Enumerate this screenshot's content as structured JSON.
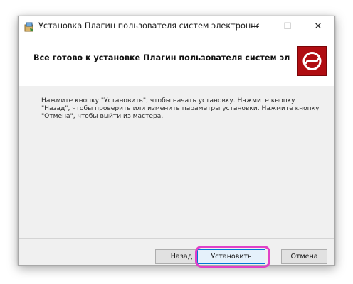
{
  "window": {
    "title": "Установка Плагин пользователя систем электронного пр...",
    "controls": {
      "minimize": "—",
      "maximize": "☐",
      "close": "✕"
    }
  },
  "banner": {
    "title": "Все готово к установке Плагин пользователя систем электр..."
  },
  "content": {
    "description": "Нажмите кнопку \"Установить\", чтобы начать установку. Нажмите кнопку \"Назад\", чтобы проверить или изменить параметры установки. Нажмите кнопку \"Отмена\", чтобы выйти из мастера."
  },
  "buttons": {
    "back": "Назад",
    "install": "Установить",
    "cancel": "Отмена"
  },
  "colors": {
    "logo_red": "#b00d12",
    "highlight": "#e040c8",
    "focus_border": "#0078d7"
  },
  "icons": {
    "app": "installer-package-icon",
    "logo": "plugin-logo-icon"
  }
}
